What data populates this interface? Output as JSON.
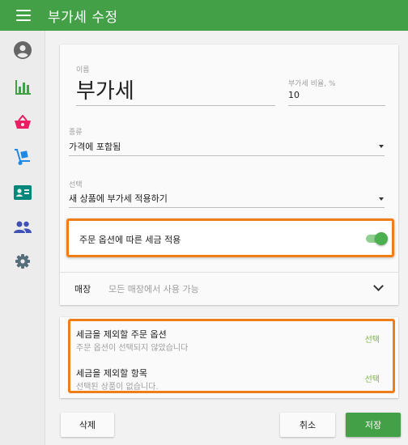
{
  "appbar": {
    "title": "부가세 수정",
    "menu_icon": "hamburger-menu-icon"
  },
  "sidebar": {
    "items": [
      {
        "icon": "account-circle-icon",
        "color": "#666666"
      },
      {
        "icon": "bar-chart-icon",
        "color": "#43a047"
      },
      {
        "icon": "shopping-basket-icon",
        "color": "#e91e63"
      },
      {
        "icon": "hand-truck-icon",
        "color": "#1e88e5"
      },
      {
        "icon": "id-card-icon",
        "color": "#00897b"
      },
      {
        "icon": "people-icon",
        "color": "#3f51b5"
      },
      {
        "icon": "gear-icon",
        "color": "#546e7a"
      }
    ]
  },
  "form": {
    "name_label": "이름",
    "name_value": "부가세",
    "rate_label": "부가세 비율, %",
    "rate_value": "10",
    "type_label": "종류",
    "type_value": "가격에 포함됨",
    "option_label": "선택",
    "option_value": "새 상품에 부가세 적용하기",
    "toggle_label": "주문 옵션에 따른 세금 적용",
    "toggle_on": true,
    "store_label": "매장",
    "store_value": "모든 매장에서 사용 가능"
  },
  "exclusions": {
    "options_title": "세금을 제외할 주문 옵션",
    "options_sub": "주문 옵션이 선택되지 않았습니다",
    "options_link": "선택",
    "items_title": "세금을 제외할 항목",
    "items_sub": "선택된 상품이 없습니다.",
    "items_link": "선택"
  },
  "footer": {
    "delete_label": "삭제",
    "cancel_label": "취소",
    "save_label": "저장"
  },
  "colors": {
    "primary": "#43a047",
    "highlight": "#ef7d1a",
    "link": "#7cb342"
  }
}
